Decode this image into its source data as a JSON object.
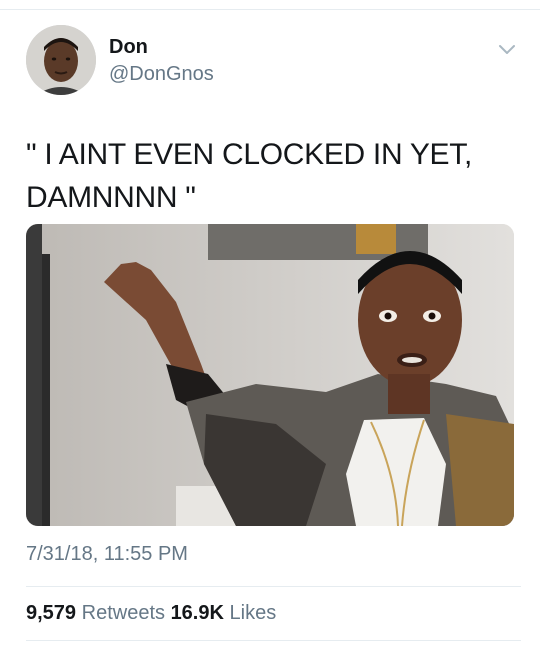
{
  "author": {
    "display_name": "Don",
    "handle": "@DonGnos"
  },
  "tweet": {
    "text_line1": "\" I AINT EVEN CLOCKED IN YET,",
    "text_line2": "DAMNNNN \"",
    "timestamp": "7/31/18, 11:55 PM"
  },
  "stats": {
    "retweets_count": "9,579",
    "retweets_label": "Retweets",
    "likes_count": "16.9K",
    "likes_label": "Likes"
  },
  "icons": {
    "menu": "chevron-down-icon"
  },
  "colors": {
    "primary_text": "#14171a",
    "secondary_text": "#657786",
    "divider": "#e6ecf0"
  }
}
